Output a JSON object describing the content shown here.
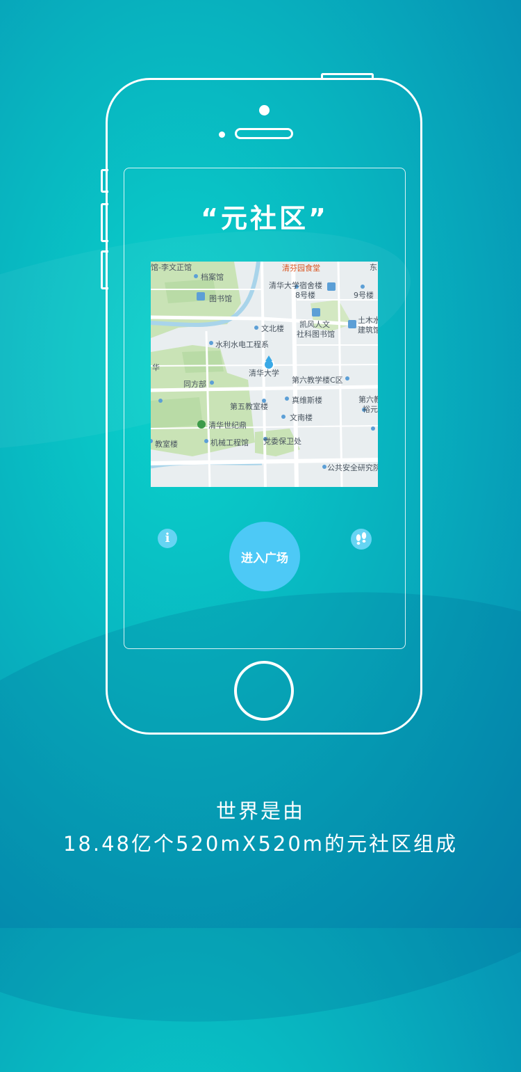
{
  "screen": {
    "title": "“元社区”",
    "enter_button_label": "进入广场"
  },
  "map": {
    "labels": [
      {
        "text": "馆-李文正馆",
        "color": "normal"
      },
      {
        "text": "清芬园食堂",
        "color": "red"
      },
      {
        "text": "东",
        "color": "normal"
      },
      {
        "text": "档案馆",
        "color": "normal"
      },
      {
        "text": "清华大学宿舍楼",
        "color": "normal"
      },
      {
        "text": "8号楼",
        "color": "normal"
      },
      {
        "text": "9号楼",
        "color": "normal"
      },
      {
        "text": "图书馆",
        "color": "normal"
      },
      {
        "text": "凯风人文",
        "color": "normal"
      },
      {
        "text": "社科图书馆",
        "color": "normal"
      },
      {
        "text": "土木水",
        "color": "normal"
      },
      {
        "text": "建筑馆",
        "color": "normal"
      },
      {
        "text": "文北楼",
        "color": "normal"
      },
      {
        "text": "水利水电工程系",
        "color": "normal"
      },
      {
        "text": "华",
        "color": "normal"
      },
      {
        "text": "清华大学",
        "color": "normal"
      },
      {
        "text": "同方部",
        "color": "normal"
      },
      {
        "text": "第六教学楼C区",
        "color": "normal"
      },
      {
        "text": "真维斯楼",
        "color": "normal"
      },
      {
        "text": "第六教",
        "color": "normal"
      },
      {
        "text": "第五教室楼",
        "color": "normal"
      },
      {
        "text": "裕元",
        "color": "normal"
      },
      {
        "text": "文南楼",
        "color": "normal"
      },
      {
        "text": "清华世纪鼎",
        "color": "normal"
      },
      {
        "text": "教室楼",
        "color": "normal"
      },
      {
        "text": "机械工程馆",
        "color": "normal"
      },
      {
        "text": "党委保卫处",
        "color": "normal"
      },
      {
        "text": "公共安全研究院",
        "color": "normal"
      }
    ]
  },
  "icons": {
    "info": "info-icon",
    "footprints": "footprints-icon"
  },
  "caption": {
    "line1": "世界是由",
    "line2": "18.48亿个520mX520m的元社区组成"
  },
  "colors": {
    "background": "#08b3bf",
    "button": "#4dc9f6",
    "map_green": "#c9e3b6",
    "map_road": "#ffffff"
  }
}
